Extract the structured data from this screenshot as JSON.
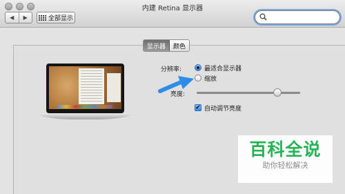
{
  "window": {
    "title": "内建 Retina 显示器"
  },
  "toolbar": {
    "back_glyph": "◀",
    "forward_glyph": "▶",
    "show_all_label": "全部显示",
    "search_value": ""
  },
  "tabs": [
    {
      "label": "显示器",
      "selected": true
    },
    {
      "label": "颜色",
      "selected": false
    }
  ],
  "display": {
    "resolution_label": "分辨率:",
    "options": [
      {
        "label": "最适合显示器",
        "selected": true
      },
      {
        "label": "缩放",
        "selected": false
      }
    ],
    "brightness_label": "亮度:",
    "brightness_level": 0.78,
    "auto_brightness_label": "自动调节亮度",
    "auto_brightness_checked": true,
    "check_glyph": "✔"
  },
  "watermark": {
    "main": "百科全说",
    "sub": "助你轻松解决"
  },
  "colors": {
    "accent": "#3d86de",
    "arrow": "#2e8de8",
    "watermark_green": "#1bb14c"
  }
}
